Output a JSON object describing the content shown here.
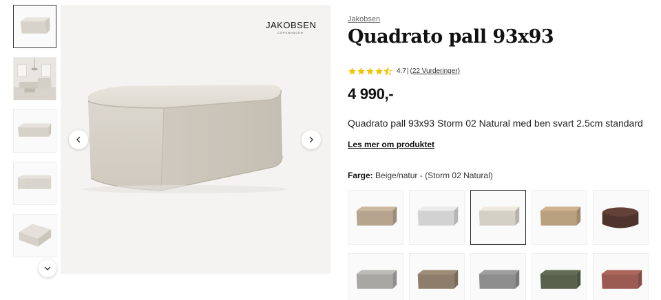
{
  "gallery": {
    "thumbnails": [
      {
        "name": "thumb-ottoman-front",
        "color": "#d8d3ca",
        "active": true
      },
      {
        "name": "thumb-room-scene",
        "color": "#d5d0c7",
        "active": false
      },
      {
        "name": "thumb-ottoman-side",
        "color": "#dad6ce",
        "active": false
      },
      {
        "name": "thumb-ottoman-low",
        "color": "#dcd8d0",
        "active": false
      },
      {
        "name": "thumb-ottoman-top",
        "color": "#d9d5cd",
        "active": false
      }
    ],
    "scroll_down_icon": "chevron-down-icon",
    "prev_icon": "chevron-left-icon",
    "next_icon": "chevron-right-icon"
  },
  "logo": {
    "name": "JAKOBSEN",
    "sub": "COPENHAGEN"
  },
  "product": {
    "brand": "Jakobsen",
    "title": "Quadrato pall 93x93",
    "rating": {
      "value": "4.7",
      "separator": "|",
      "count": "(22 Vurderinger)",
      "stars": 4.5,
      "star_color": "#f2c300"
    },
    "price": "4 990,-",
    "description": "Quadrato pall 93x93 Storm 02 Natural med ben svart 2.5cm standard",
    "read_more": "Les mer om produktet",
    "color_label": "Farge:",
    "color_value": "Beige/natur - (Storm 02 Natural)"
  },
  "swatches": [
    {
      "color": "#b7a48f",
      "shape": "square",
      "selected": false
    },
    {
      "color": "#d2d2d2",
      "shape": "square",
      "selected": false
    },
    {
      "color": "#d5d0c6",
      "shape": "square",
      "selected": true
    },
    {
      "color": "#b9a07f",
      "shape": "square",
      "selected": false
    },
    {
      "color": "#4e342c",
      "shape": "round",
      "selected": false
    },
    {
      "color": "#a9a7a4",
      "shape": "square",
      "selected": false
    },
    {
      "color": "#8e7d6a",
      "shape": "square",
      "selected": false
    },
    {
      "color": "#8d8d8d",
      "shape": "square",
      "selected": false
    },
    {
      "color": "#59604c",
      "shape": "square",
      "selected": false
    },
    {
      "color": "#9b5a52",
      "shape": "square",
      "selected": false
    }
  ]
}
